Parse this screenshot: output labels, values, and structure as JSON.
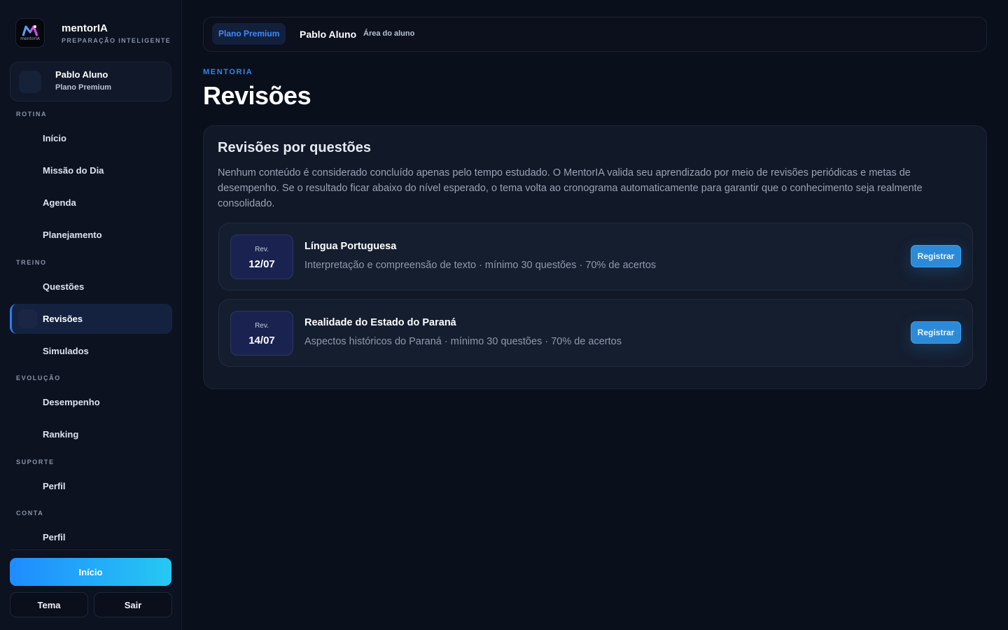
{
  "brand": {
    "name": "mentorIA",
    "tagline": "PREPARAÇÃO INTELIGENTE",
    "logo_text": "mentorIA"
  },
  "user": {
    "name": "Pablo Aluno",
    "plan": "Plano Premium"
  },
  "sidebar": {
    "sections": [
      {
        "label": "ROTINA",
        "items": [
          "Início",
          "Missão do Dia",
          "Agenda",
          "Planejamento"
        ]
      },
      {
        "label": "TREINO",
        "items": [
          "Questões",
          "Revisões",
          "Simulados"
        ]
      },
      {
        "label": "EVOLUÇÃO",
        "items": [
          "Desempenho",
          "Ranking"
        ]
      },
      {
        "label": "SUPORTE",
        "items": [
          "Perfil"
        ]
      },
      {
        "label": "CONTA",
        "items": [
          "Perfil"
        ]
      }
    ],
    "active_item": "Revisões",
    "primary_button": "Início",
    "theme_button": "Tema",
    "logout_button": "Sair"
  },
  "topbar": {
    "plan_badge": "Plano Premium",
    "user_name": "Pablo Aluno",
    "area_label": "Área do aluno"
  },
  "header": {
    "eyebrow": "MENTORIA",
    "title": "Revisões"
  },
  "panel": {
    "title": "Revisões por questões",
    "description": "Nenhum conteúdo é considerado concluído apenas pelo tempo estudado. O MentorIA valida seu aprendizado por meio de revisões periódicas e metas de desempenho. Se o resultado ficar abaixo do nível esperado, o tema volta ao cronograma automaticamente para garantir que o conhecimento seja realmente consolidado.",
    "reviews": [
      {
        "rev_label": "Rev.",
        "date": "12/07",
        "subject": "Língua Portuguesa",
        "detail": "Interpretação e compreensão de texto · mínimo 30 questões · 70% de acertos",
        "button": "Registrar"
      },
      {
        "rev_label": "Rev.",
        "date": "14/07",
        "subject": "Realidade do Estado do Paraná",
        "detail": "Aspectos históricos do Paraná · mínimo 30 questões · 70% de acertos",
        "button": "Registrar"
      }
    ]
  },
  "colors": {
    "background": "#0a0f1c",
    "accent": "#2f86f0",
    "active_nav": "#142240",
    "button_gradient_start": "#1f8bff",
    "button_gradient_end": "#26c8f2"
  }
}
